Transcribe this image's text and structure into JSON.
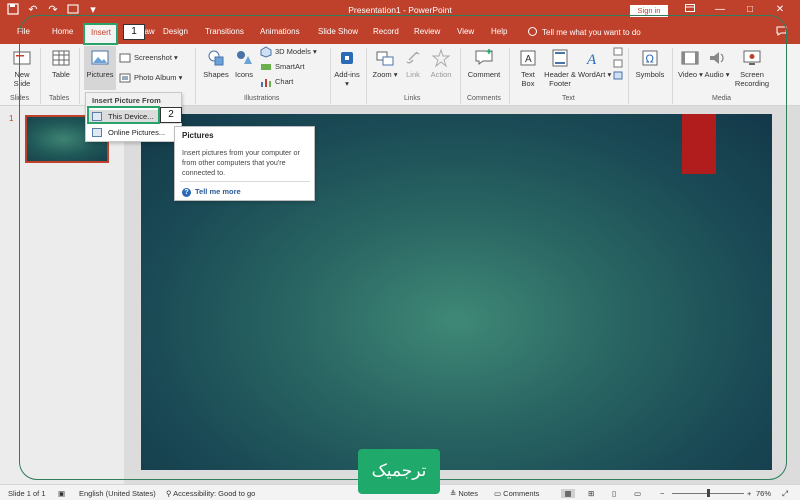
{
  "titlebar": {
    "doc_title": "Presentation1 - PowerPoint",
    "signin_label": "Sign in",
    "qat_icons": [
      "save-icon",
      "undo-icon",
      "redo-icon",
      "start-from-beginning-icon",
      "customize-qat-icon"
    ],
    "window_controls": [
      "ribbon-display-icon",
      "minimize-icon",
      "maximize-icon",
      "close-icon"
    ]
  },
  "tabs": [
    "File",
    "Home",
    "Insert",
    "Draw",
    "Design",
    "Transitions",
    "Animations",
    "Slide Show",
    "Record",
    "Review",
    "View",
    "Help"
  ],
  "tell_me": "Tell me what you want to do",
  "ribbon": {
    "new_slide": "New Slide",
    "table": "Table",
    "pictures": "Pictures",
    "screenshot": "Screenshot",
    "photo_album": "Photo Album",
    "shapes": "Shapes",
    "icons": "Icons",
    "models3d": "3D Models",
    "smartart": "SmartArt",
    "chart": "Chart",
    "addins": "Add-ins",
    "zoom": "Zoom",
    "link": "Link",
    "action": "Action",
    "comment": "Comment",
    "textbox": "Text Box",
    "header_footer": "Header & Footer",
    "wordart": "WordArt",
    "symbols": "Symbols",
    "video": "Video",
    "audio": "Audio",
    "screen_recording": "Screen Recording",
    "groups": [
      "Slides",
      "Tables",
      "Illustrations",
      "Links",
      "Comments",
      "Text",
      "Media"
    ]
  },
  "dropdown": {
    "header": "Insert Picture From",
    "items": [
      "This Device...",
      "Online Pictures..."
    ]
  },
  "tooltip": {
    "title": "Pictures",
    "body": "Insert pictures from your computer or from other computers that you're connected to.",
    "more": "Tell me more"
  },
  "annotations": {
    "badge1": "1",
    "badge2": "2"
  },
  "slide_panel": {
    "slide_number": "1"
  },
  "statusbar": {
    "slide_info": "Slide 1 of 1",
    "language": "English (United States)",
    "accessibility": "Accessibility: Good to go",
    "notes": "Notes",
    "comments": "Comments",
    "zoom_level": "76%",
    "zoom_fraction": 0.38
  },
  "logo_text": "ترجمیک",
  "colors": {
    "accent": "#c0412b",
    "highlight": "#2aa36b",
    "slide_dark": "#133849",
    "slide_light": "#3f8876",
    "red_bar": "#b11c1c"
  }
}
